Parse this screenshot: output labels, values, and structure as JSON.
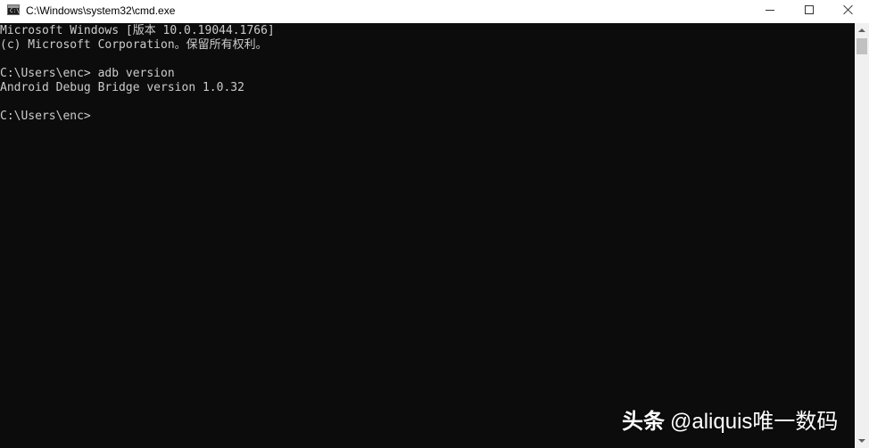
{
  "window": {
    "title": "C:\\Windows\\system32\\cmd.exe",
    "icon": "cmd-icon"
  },
  "title_buttons": {
    "minimize_icon": "minimize-icon",
    "maximize_icon": "maximize-icon",
    "close_icon": "close-icon"
  },
  "console": {
    "lines": [
      "Microsoft Windows [版本 10.0.19044.1766]",
      "(c) Microsoft Corporation。保留所有权利。",
      "",
      "C:\\Users\\enc> adb version",
      "Android Debug Bridge version 1.0.32",
      "",
      "C:\\Users\\enc>"
    ],
    "foreground": "#cccccc",
    "background": "#0c0c0c"
  },
  "watermark": {
    "brand": "头条",
    "handle": "@aliquis唯一数码"
  }
}
